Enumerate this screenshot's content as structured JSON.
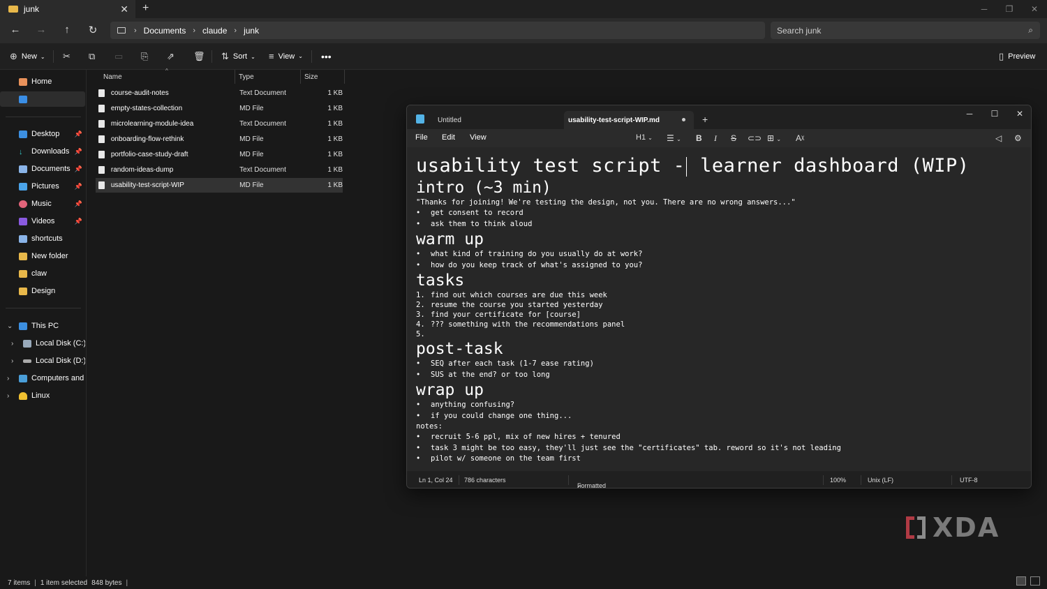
{
  "explorer": {
    "tab_title": "junk",
    "breadcrumb": [
      "Documents",
      "claude",
      "junk"
    ],
    "search_placeholder": "Search junk",
    "commands": {
      "new": "New",
      "sort": "Sort",
      "view": "View",
      "preview": "Preview"
    },
    "sidebar": {
      "home": "Home",
      "pinned": [
        "Desktop",
        "Downloads",
        "Documents",
        "Pictures",
        "Music",
        "Videos"
      ],
      "folders": [
        "shortcuts",
        "New folder",
        "claw",
        "Design"
      ],
      "this_pc": "This PC",
      "drives": [
        "Local Disk (C:)",
        "Local Disk (D:)"
      ],
      "network": "Computers and De",
      "linux": "Linux"
    },
    "columns": [
      "Name",
      "Type",
      "Size"
    ],
    "files": [
      {
        "name": "course-audit-notes",
        "type": "Text Document",
        "size": "1 KB"
      },
      {
        "name": "empty-states-collection",
        "type": "MD File",
        "size": "1 KB"
      },
      {
        "name": "microlearning-module-idea",
        "type": "Text Document",
        "size": "1 KB"
      },
      {
        "name": "onboarding-flow-rethink",
        "type": "MD File",
        "size": "1 KB"
      },
      {
        "name": "portfolio-case-study-draft",
        "type": "MD File",
        "size": "1 KB"
      },
      {
        "name": "random-ideas-dump",
        "type": "Text Document",
        "size": "1 KB"
      },
      {
        "name": "usability-test-script-WIP",
        "type": "MD File",
        "size": "1 KB"
      }
    ],
    "status": {
      "items": "7 items",
      "selected": "1 item selected",
      "bytes": "848 bytes"
    }
  },
  "notepad": {
    "tab1": "Untitled",
    "tab2": "usability-test-script-WIP.md",
    "menu": [
      "File",
      "Edit",
      "View"
    ],
    "heading_selector": "H1",
    "content": {
      "title_before_cursor": "usability test script -",
      "title_after_cursor": " learner dashboard (WIP)",
      "intro_h": "intro (~3 min)",
      "intro_p": "\"Thanks for joining! We're testing the design, not you. There are no wrong answers...\"",
      "intro_items": [
        "get consent to record",
        "ask them to think aloud"
      ],
      "warm_h": "warm up",
      "warm_items": [
        "what kind of training do you usually do at work?",
        "how do you keep track of what's assigned to you?"
      ],
      "tasks_h": "tasks",
      "tasks_items": [
        "find out which courses are due this week",
        "resume the course you started yesterday",
        "find your certificate for [course]",
        "??? something with the recommendations panel",
        ""
      ],
      "post_h": "post-task",
      "post_items": [
        "SEQ after each task (1-7 ease rating)",
        "SUS at the end? or too long"
      ],
      "wrap_h": "wrap up",
      "wrap_items": [
        "anything confusing?",
        "if you could change one thing..."
      ],
      "notes_label": "notes:",
      "notes_items": [
        "recruit 5-6 ppl, mix of new hires + tenured",
        "task 3 might be too easy, they'll just see the \"certificates\" tab. reword so it's not leading",
        "pilot w/ someone on the team first"
      ]
    },
    "status": {
      "position": "Ln 1, Col 24",
      "chars": "786 characters",
      "mode": "Formatted",
      "zoom": "100%",
      "eol": "Unix (LF)",
      "encoding": "UTF-8"
    }
  },
  "watermark": "XDA"
}
